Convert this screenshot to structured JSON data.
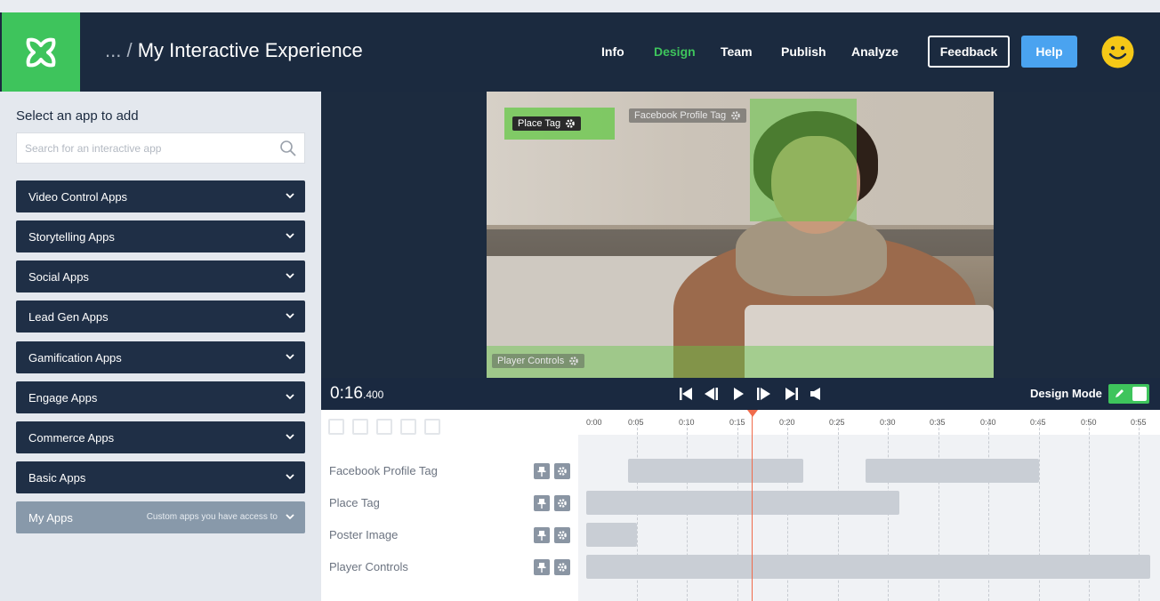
{
  "header": {
    "crumb_prefix": "... /",
    "title": "My Interactive Experience",
    "nav": [
      "Info",
      "Design",
      "Team",
      "Publish",
      "Analyze"
    ],
    "active_nav": "Design",
    "feedback_label": "Feedback",
    "help_label": "Help"
  },
  "sidebar": {
    "title": "Select an app to add",
    "search_placeholder": "Search for an interactive app",
    "categories": [
      "Video Control Apps",
      "Storytelling Apps",
      "Social Apps",
      "Lead Gen Apps",
      "Gamification Apps",
      "Engage Apps",
      "Commerce Apps",
      "Basic Apps"
    ],
    "my_apps": {
      "label": "My Apps",
      "subtitle": "Custom apps you have access to"
    }
  },
  "stage": {
    "tags": {
      "place": "Place Tag",
      "facebook": "Facebook Profile Tag",
      "player": "Player Controls"
    }
  },
  "player": {
    "time_main": "0:16",
    "time_ms": ".400",
    "design_mode_label": "Design Mode",
    "design_mode_on": true
  },
  "timeline": {
    "ticks": [
      "0:00",
      "0:05",
      "0:10",
      "0:15",
      "0:20",
      "0:25",
      "0:30",
      "0:35",
      "0:40",
      "0:45",
      "0:50",
      "0:55"
    ],
    "tracks": [
      "Facebook Profile Tag",
      "Place Tag",
      "Poster Image",
      "Player Controls"
    ],
    "playhead_time": "0:16.400"
  },
  "colors": {
    "accent_green": "#3ec45c",
    "navy": "#1b2a3f",
    "help_blue": "#4aa3f0",
    "playhead": "#f06b4b"
  }
}
